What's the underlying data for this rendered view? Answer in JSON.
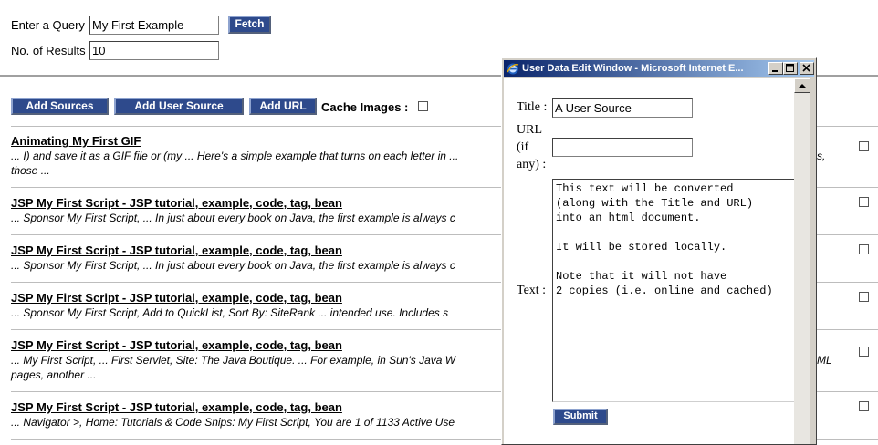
{
  "query": {
    "label": "Enter a Query",
    "value": "My First Example",
    "fetch_label": "Fetch",
    "results_label": "No. of Results",
    "results_value": "10"
  },
  "toolbar": {
    "add_sources": "Add Sources",
    "add_user_source": "Add User Source",
    "add_url": "Add URL",
    "cache_images": "Cache Images :"
  },
  "results": [
    {
      "title": "Animating My First GIF",
      "snippet": "... I) and save it as a GIF file or (my ... Here's a simple example that turns on each letter in ...",
      "snippet_right": "s,",
      "snippet2": "those ..."
    },
    {
      "title": "JSP My First Script - JSP tutorial, example, code, tag, bean",
      "snippet": "... Sponsor My First Script, ... In just about every book on Java, the first example is always c",
      "snippet_right": "",
      "snippet2": ""
    },
    {
      "title": "JSP My First Script - JSP tutorial, example, code, tag, bean",
      "snippet": "... Sponsor My First Script, ... In just about every book on Java, the first example is always c",
      "snippet_right": "",
      "snippet2": ""
    },
    {
      "title": "JSP My First Script - JSP tutorial, example, code, tag, bean",
      "snippet": "... Sponsor My First Script, Add to QuickList, Sort By: SiteRank ... intended use. Includes s",
      "snippet_right": "",
      "snippet2": ""
    },
    {
      "title": "JSP My First Script - JSP tutorial, example, code, tag, bean",
      "snippet": "... My First Script, ... First Servlet, Site: The Java Boutique. ... For example, in Sun's Java W",
      "snippet_right": "ML",
      "snippet2": "pages, another ..."
    },
    {
      "title": "JSP My First Script - JSP tutorial, example, code, tag, bean",
      "snippet": "... Navigator >, Home: Tutorials & Code Snips: My First Script, You are 1 of 1133 Active Use",
      "snippet_right": "",
      "snippet2": ""
    }
  ],
  "popup": {
    "title": "User Data Edit Window - Microsoft Internet E...",
    "title_label": "Title :",
    "title_value": "A User Source",
    "url_label_1": "URL",
    "url_label_2": "(if",
    "url_label_3": "any) :",
    "url_value": "",
    "text_label": "Text :",
    "text_value": "This text will be converted\n(along with the Title and URL)\ninto an html document.\n\nIt will be stored locally.\n\nNote that it will not have\n2 copies (i.e. online and cached)",
    "submit_label": "Submit"
  },
  "icons": {
    "window_icon": "ie-icon",
    "minimize": "minimize-icon",
    "maximize": "maximize-icon",
    "close": "close-icon"
  }
}
